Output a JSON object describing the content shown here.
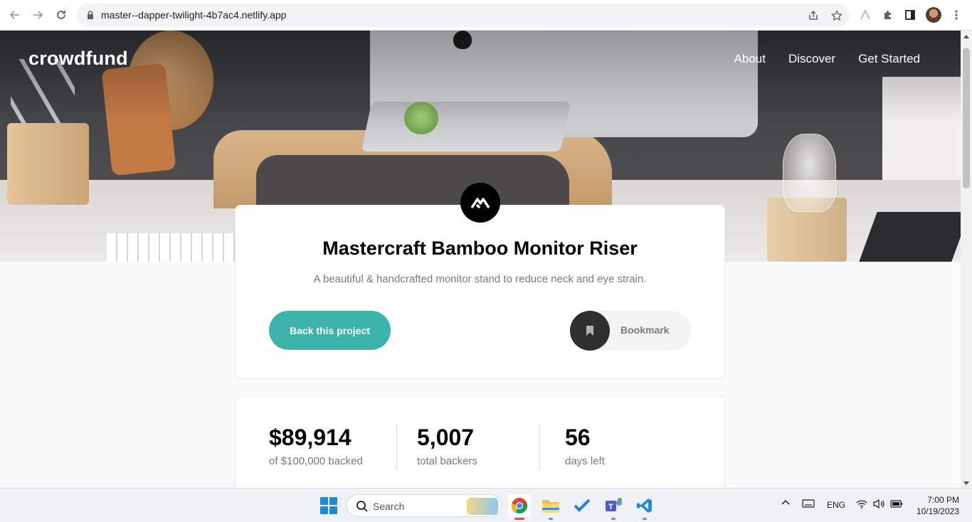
{
  "browser": {
    "url": "master--dapper-twilight-4b7ac4.netlify.app",
    "icons": [
      "back-arrow-icon",
      "forward-arrow-icon",
      "reload-icon",
      "lock-icon",
      "share-icon",
      "star-icon",
      "extension-icon",
      "puzzle-icon",
      "sidebar-icon",
      "avatar",
      "more-vert-icon"
    ]
  },
  "site": {
    "logo": "crowdfund",
    "nav": [
      "About",
      "Discover",
      "Get Started"
    ]
  },
  "project": {
    "title": "Mastercraft Bamboo Monitor Riser",
    "description": "A beautiful & handcrafted monitor stand to reduce neck and eye strain.",
    "back_button": "Back this project",
    "bookmark_label": "Bookmark"
  },
  "stats": [
    {
      "value": "$89,914",
      "label": "of $100,000 backed"
    },
    {
      "value": "5,007",
      "label": "total backers"
    },
    {
      "value": "56",
      "label": "days left"
    }
  ],
  "taskbar": {
    "search_placeholder": "Search",
    "language": "ENG",
    "time": "7:00 PM",
    "date": "10/19/2023"
  },
  "colors": {
    "accent": "#3cb3ab",
    "dark": "#2f2f2f"
  }
}
